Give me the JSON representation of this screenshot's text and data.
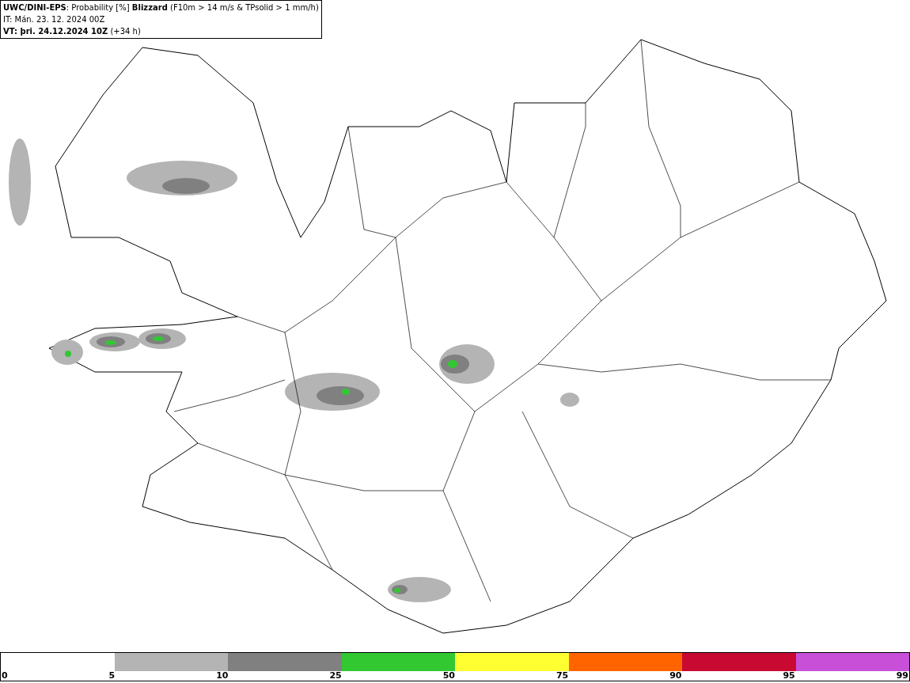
{
  "header": {
    "lines": [
      "**UWC/DINI-EPS**: Probability [%] **Blizzard** (F10m > 14 m/s & TPsolid > 1 mm/h)",
      "IT: Mán. 23. 12. 2024 00Z",
      "**VT: þri. 24.12.2024 10Z** (+34 h)"
    ]
  },
  "legend": {
    "segments": [
      {
        "color": "#b4b4b4"
      },
      {
        "color": "#808080"
      },
      {
        "color": "#32c832"
      },
      {
        "color": "#ffff32"
      },
      {
        "color": "#ff6400"
      },
      {
        "color": "#c80a32"
      },
      {
        "color": "#c850d8"
      }
    ],
    "ticks": [
      "0",
      "5",
      "10",
      "25",
      "50",
      "75",
      "90",
      "95",
      "99"
    ]
  }
}
